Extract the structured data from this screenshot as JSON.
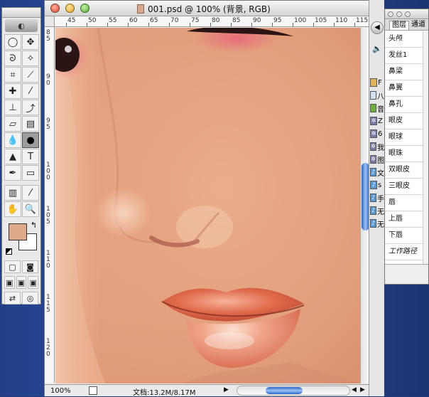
{
  "document": {
    "title": "001.psd @ 100% (背景, RGB)",
    "zoom": "100%",
    "doc_info": "文档:13.2M/8.17M"
  },
  "rulers": {
    "horizontal": [
      "45",
      "50",
      "55",
      "60",
      "65",
      "70",
      "75",
      "80",
      "85",
      "90",
      "95",
      "100",
      "105",
      "110",
      "115"
    ],
    "vertical": [
      "85",
      "90",
      "95",
      "100",
      "105",
      "110",
      "115",
      "120"
    ]
  },
  "toolbox": {
    "foreground_color": "#e0a98c",
    "background_color": "#ffffff"
  },
  "paths_panel": {
    "tabs": [
      "图层",
      "通道"
    ],
    "items": [
      "头颅",
      "发丝1",
      "鼻梁",
      "鼻翼",
      "鼻孔",
      "眼皮",
      "眼球",
      "眼珠",
      "双眼皮",
      "三眼皮",
      "唇",
      "上唇",
      "下唇",
      "工作路径"
    ]
  },
  "finder_strip": {
    "items": [
      "F",
      "八",
      "音",
      "Z",
      "6",
      "我",
      "图",
      "文",
      "s",
      "手",
      "无",
      "无"
    ]
  },
  "colors": {
    "skin": "#e4a07e",
    "lip": "#d9603f",
    "scroll_blue": "#2a62c9"
  }
}
